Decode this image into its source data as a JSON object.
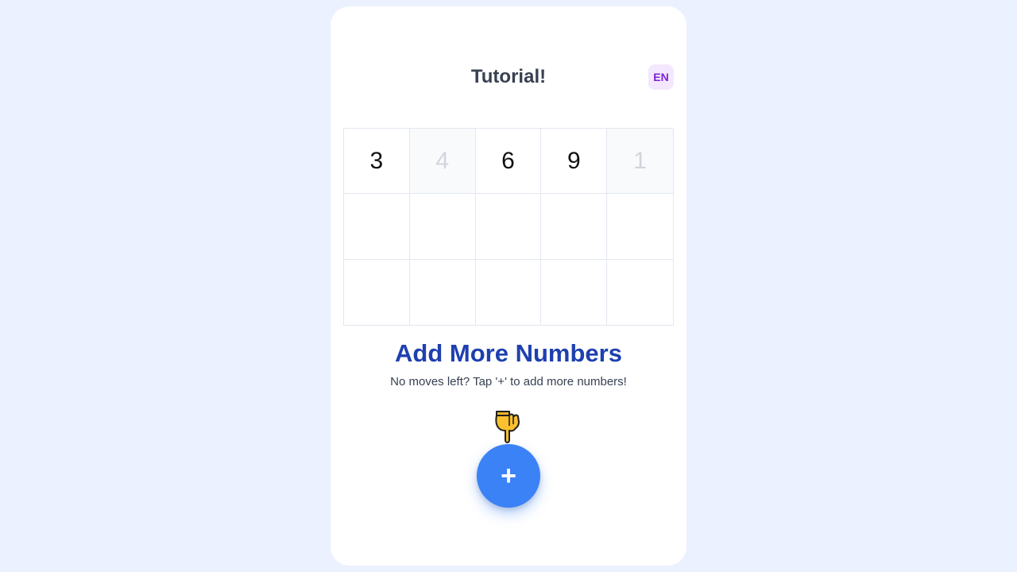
{
  "header": {
    "title": "Tutorial!",
    "language": "EN"
  },
  "grid": {
    "cells": [
      {
        "value": "3",
        "faded": false
      },
      {
        "value": "4",
        "faded": true
      },
      {
        "value": "6",
        "faded": false
      },
      {
        "value": "9",
        "faded": false
      },
      {
        "value": "1",
        "faded": true
      },
      {
        "value": "",
        "faded": false
      },
      {
        "value": "",
        "faded": false
      },
      {
        "value": "",
        "faded": false
      },
      {
        "value": "",
        "faded": false
      },
      {
        "value": "",
        "faded": false
      },
      {
        "value": "",
        "faded": false
      },
      {
        "value": "",
        "faded": false
      },
      {
        "value": "",
        "faded": false
      },
      {
        "value": "",
        "faded": false
      },
      {
        "value": "",
        "faded": false
      }
    ]
  },
  "tutorial": {
    "heading": "Add More Numbers",
    "message": "No moves left? Tap '+' to add more numbers!",
    "pointer_icon": "hand-pointing-down-icon"
  },
  "actions": {
    "add_label": "+"
  },
  "colors": {
    "accent": "#3b82f6",
    "heading": "#1e40af",
    "badge_bg": "#f3e8ff",
    "badge_text": "#7e22ce"
  }
}
